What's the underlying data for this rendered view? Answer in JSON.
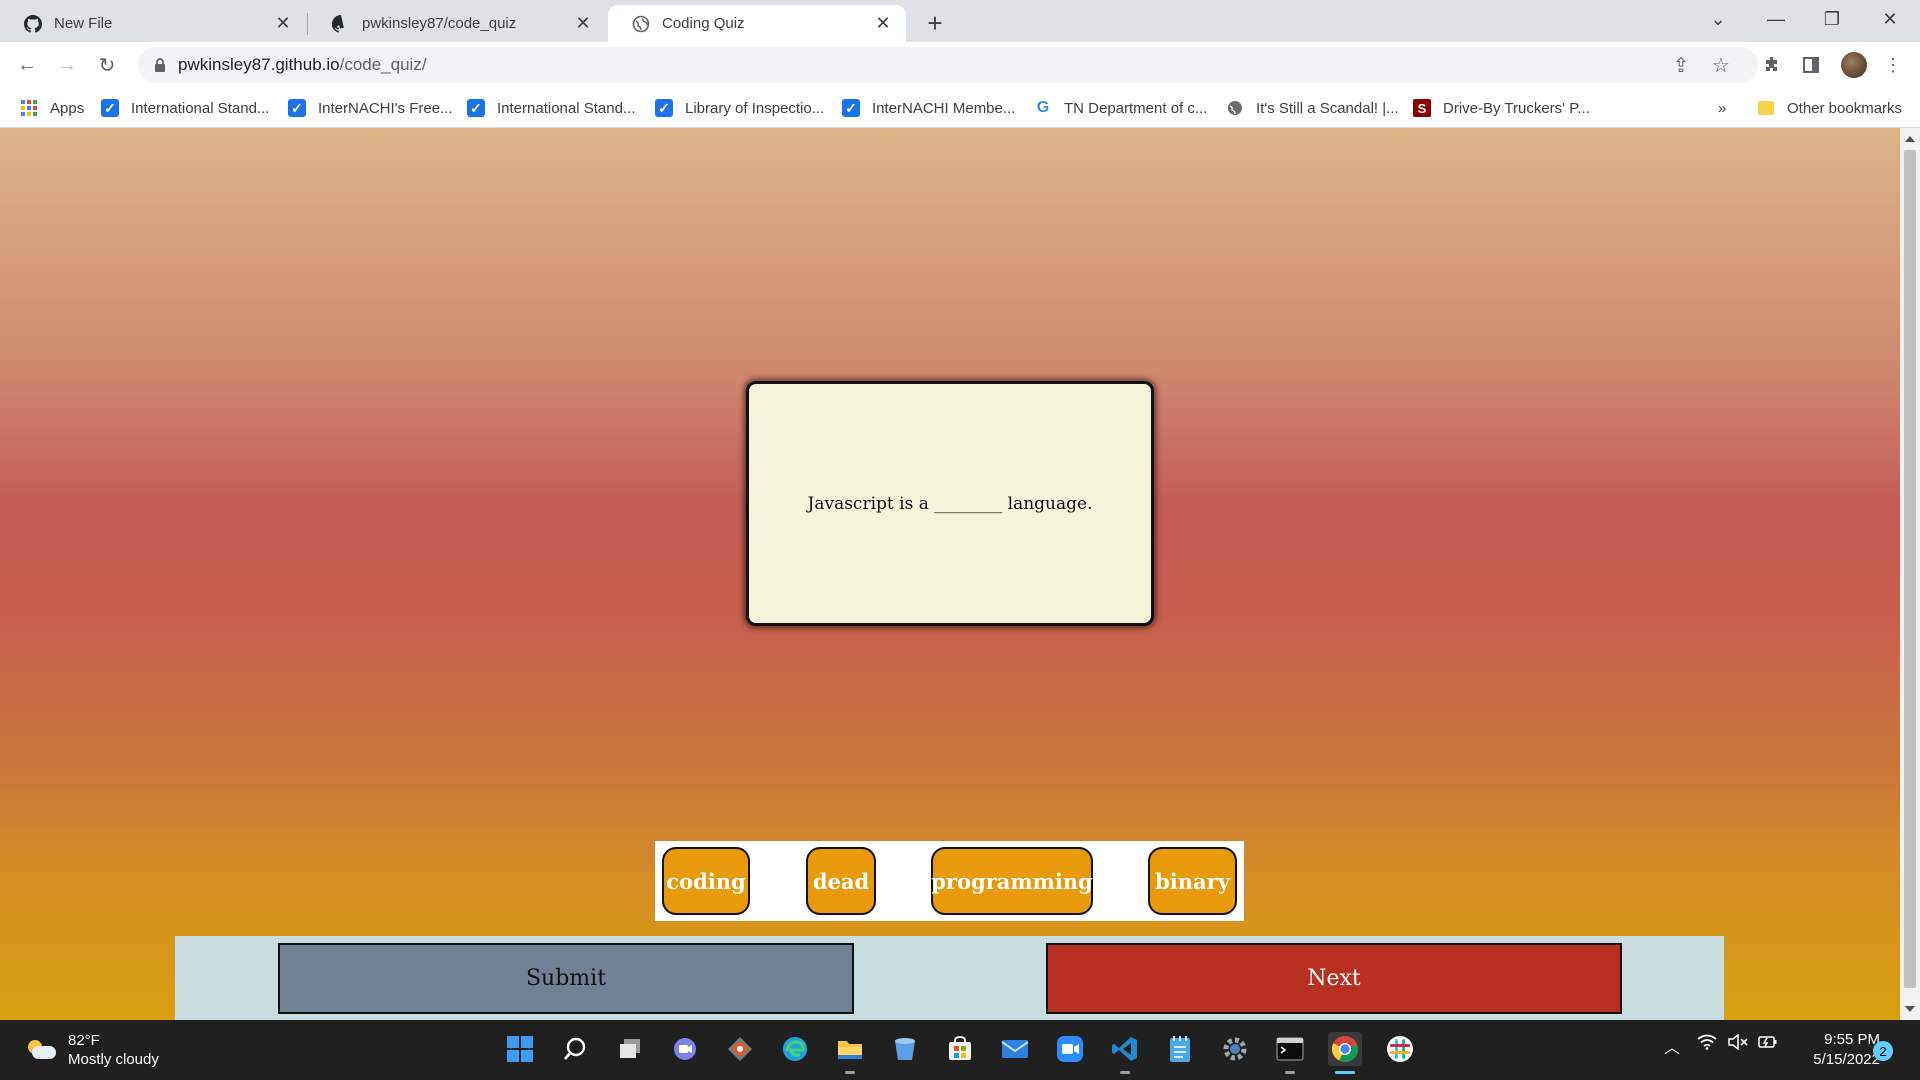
{
  "browser": {
    "tabs": [
      {
        "title": "New File",
        "icon": "github-icon"
      },
      {
        "title": "pwkinsley87/code_quiz",
        "icon": "github-icon"
      },
      {
        "title": "Coding Quiz",
        "icon": "globe-icon",
        "active": true
      }
    ],
    "url_host": "pwkinsley87.github.io",
    "url_path": "/code_quiz/",
    "bookmarks": [
      {
        "label": "Apps",
        "icon": "apps-grid-icon"
      },
      {
        "label": "International Stand...",
        "icon": "check-icon"
      },
      {
        "label": "InterNACHI's Free...",
        "icon": "check-icon"
      },
      {
        "label": "International Stand...",
        "icon": "check-icon"
      },
      {
        "label": "Library of Inspectio...",
        "icon": "check-icon"
      },
      {
        "label": "InterNACHI Membe...",
        "icon": "check-icon"
      },
      {
        "label": "TN Department of c...",
        "icon": "google-icon"
      },
      {
        "label": "It's Still a Scandal! |...",
        "icon": "globe-icon"
      },
      {
        "label": "Drive-By Truckers' P...",
        "icon": "s-icon"
      }
    ],
    "overflow_label": "»",
    "other_bookmarks": "Other bookmarks"
  },
  "quiz": {
    "question": "Javascript is a ________ language.",
    "answers": [
      "coding",
      "dead",
      "programming",
      "binary"
    ],
    "submit_label": "Submit",
    "next_label": "Next"
  },
  "taskbar": {
    "temperature": "82°F",
    "condition": "Mostly cloudy",
    "time": "9:55 PM",
    "date": "5/15/2022",
    "notification_count": "2"
  },
  "colors": {
    "answer_bg": "#e89a0a",
    "submit_bg": "#728193",
    "next_bg": "#b83020",
    "card_bg": "#f5f3dc",
    "controls_bg": "#c9dde0"
  }
}
